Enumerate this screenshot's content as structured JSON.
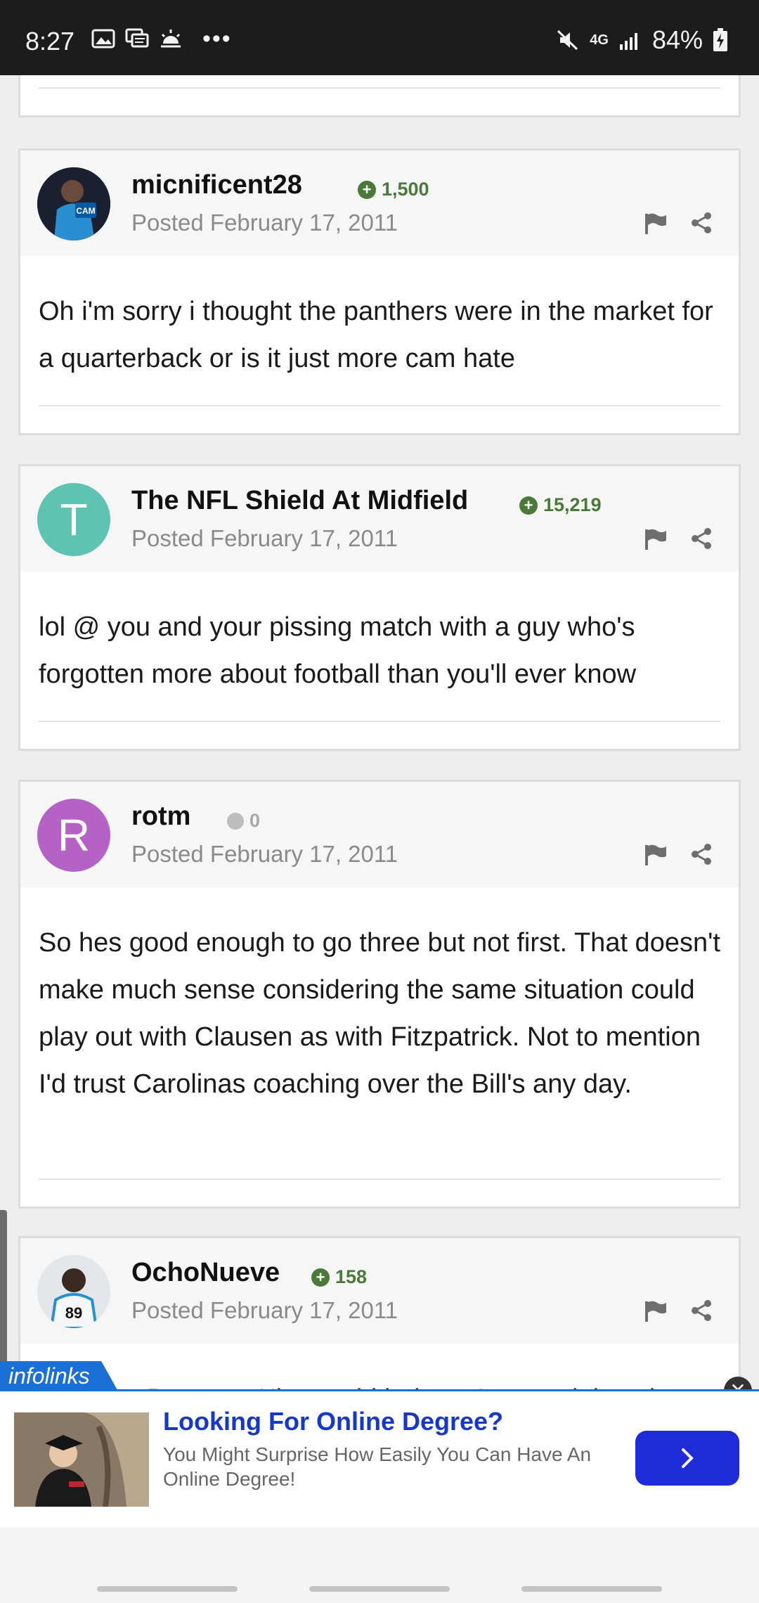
{
  "status_bar": {
    "time": "8:27",
    "network": "4G",
    "battery": "84%",
    "icons": [
      "image-icon",
      "messages-icon",
      "weather-icon",
      "more-dots-icon",
      "mute-icon",
      "signal-icon",
      "battery-icon"
    ]
  },
  "posts": [
    {
      "author": "micnificent28",
      "reputation": "1,500",
      "rep_type": "positive",
      "posted": "Posted February 17, 2011",
      "body": "Oh i'm sorry i thought the panthers were in the market for a quarterback or is it just more cam hate",
      "avatar_letter": ""
    },
    {
      "author": "The NFL Shield At Midfield",
      "reputation": "15,219",
      "rep_type": "positive",
      "posted": "Posted February 17, 2011",
      "body": "lol @ you and your pissing match with a guy who's forgotten more about football than you'll ever know",
      "avatar_letter": "T",
      "avatar_color": "#5fc3b2"
    },
    {
      "author": "rotm",
      "reputation": "0",
      "rep_type": "neutral",
      "posted": "Posted February 17, 2011",
      "body": "So hes good enough to go three but not first. That doesn't make much sense considering the same situation could play out with Clausen as with Fitzpatrick. Not to mention I'd trust Carolinas coaching over the Bill's any day.",
      "avatar_letter": "R",
      "avatar_color": "#b562c6"
    },
    {
      "author": "OchoNueve",
      "reputation": "158",
      "rep_type": "positive",
      "posted": "Posted February 17, 2011",
      "body": "Because Kiper said it doesn't mean it is going",
      "avatar_letter": ""
    }
  ],
  "ad": {
    "brand": "infolinks",
    "title": "Looking For Online Degree?",
    "description": "You Might Surprise How Easily You Can Have An Online Degree!",
    "close_label": "✕"
  },
  "colors": {
    "reputation_positive": "#4a7a3a",
    "ad_blue": "#1b6fd6",
    "ad_title": "#1538c8"
  }
}
